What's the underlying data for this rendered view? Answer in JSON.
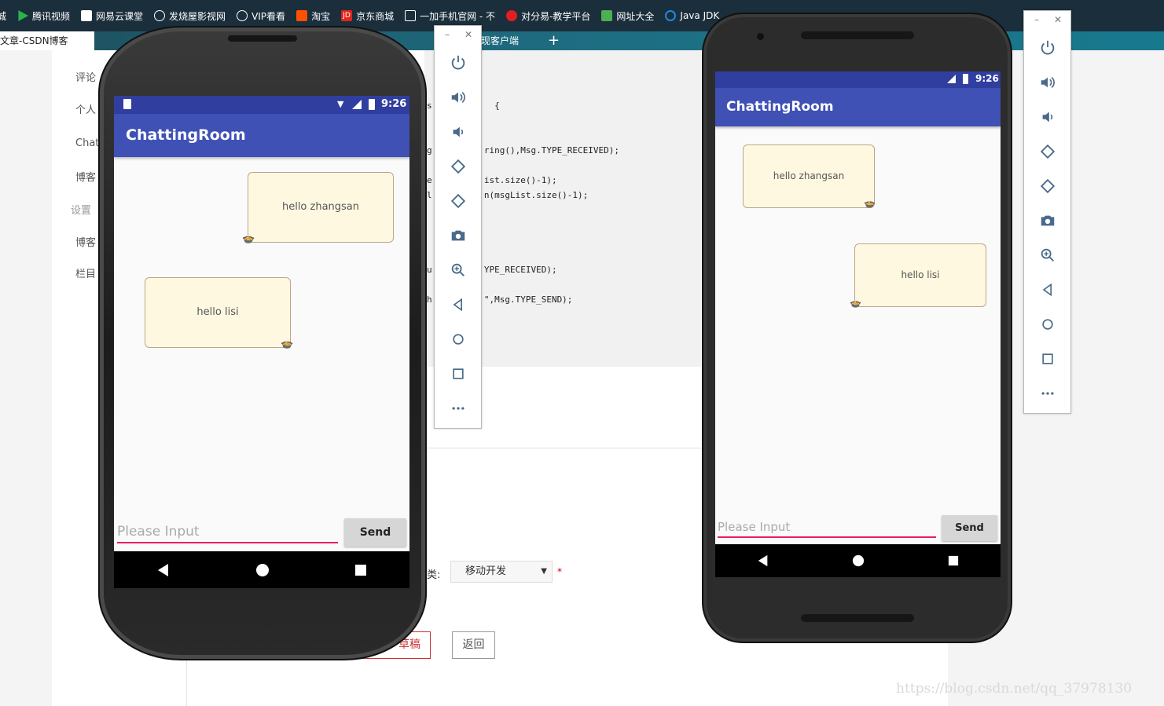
{
  "browser": {
    "bookmarks": [
      {
        "label": "腾讯视频",
        "icon": "play-icon",
        "color": "#2ab24b"
      },
      {
        "label": "网易云课堂",
        "icon": "book-icon",
        "color": "#ffffff"
      },
      {
        "label": "发烧屋影视网",
        "icon": "globe-icon",
        "color": "#ffffff"
      },
      {
        "label": "VIP看看",
        "icon": "vip-icon",
        "color": "#ffffff"
      },
      {
        "label": "淘宝",
        "icon": "taobao-icon",
        "color": "#ff5000"
      },
      {
        "label": "京东商城",
        "icon": "jd-icon",
        "color": "#e1251b"
      },
      {
        "label": "一加手机官网 - 不",
        "icon": "oneplus-icon",
        "color": "#ffffff"
      },
      {
        "label": "对分易-教学平台",
        "icon": "duifenyi-icon",
        "color": "#e02020"
      },
      {
        "label": "网址大全",
        "icon": "hao-icon",
        "color": "#4caf50"
      },
      {
        "label": "Java JDK",
        "icon": "java-icon",
        "color": "#1e88e5"
      }
    ],
    "active_tab": "文章-CSDN博客",
    "second_tab": "实现客户端",
    "new_tab_symbol": "+"
  },
  "editor": {
    "left_menu": [
      "评论",
      "个人",
      "Chat",
      "博客",
      "设置",
      "博客",
      "栏目"
    ],
    "code_lines": [
      {
        "text": "s            {"
      },
      {
        "text": "g          ring(),Msg.TYPE_RECEIVED);"
      },
      {
        "text": "e          ist.size()-1);"
      },
      {
        "text": "l          n(msgList.size()-1);"
      },
      {
        "text": "u          YPE_RECEIVED);"
      },
      {
        "text": "h          \",Msg.TYPE_SEND);"
      }
    ],
    "category_label": "类:",
    "category_value": "移动开发",
    "required_mark": "*",
    "draft_button": "草稿",
    "back_button": "返回",
    "watermark": "https://blog.csdn.net/qq_37978130"
  },
  "phone_left": {
    "time": "9:26",
    "app_title": "ChattingRoom",
    "messages": [
      {
        "text": "hello zhangsan",
        "side": "right"
      },
      {
        "text": "hello lisi",
        "side": "left"
      }
    ],
    "input_placeholder": "Please Input",
    "send_label": "Send"
  },
  "phone_right": {
    "time": "9:26",
    "app_title": "ChattingRoom",
    "messages": [
      {
        "text": "hello zhangsan",
        "side": "left"
      },
      {
        "text": "hello lisi",
        "side": "right"
      }
    ],
    "input_placeholder": "Please Input",
    "send_label": "Send"
  },
  "emulator_controls": [
    "power-icon",
    "volume-up-icon",
    "volume-down-icon",
    "rotate-left-icon",
    "rotate-right-icon",
    "camera-icon",
    "zoom-icon",
    "back-icon",
    "home-icon",
    "overview-icon",
    "more-icon"
  ],
  "colors": {
    "primary": "#3f51b5",
    "primary_dark": "#303f9f",
    "accent": "#e91e63",
    "bubble": "#fff8e1"
  }
}
